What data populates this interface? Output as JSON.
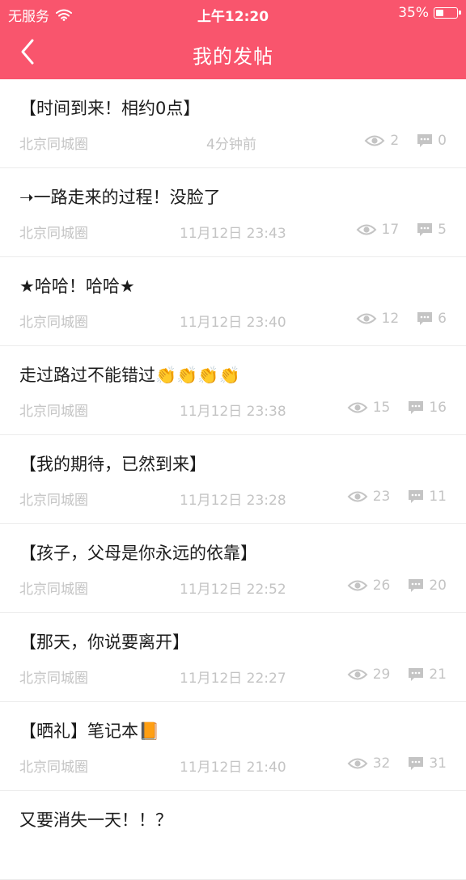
{
  "status_bar": {
    "carrier": "无服务",
    "time": "上午12:20",
    "battery": "35%",
    "battery_level": 0.35
  },
  "nav": {
    "title": "我的发帖"
  },
  "posts": [
    {
      "title": "【时间到来！相约0点】",
      "source": "北京同城圈",
      "time": "4分钟前",
      "views": "2",
      "comments": "0"
    },
    {
      "title": "➝一路走来的过程！没脸了",
      "source": "北京同城圈",
      "time": "11月12日 23:43",
      "views": "17",
      "comments": "5"
    },
    {
      "title": "★哈哈！哈哈★",
      "source": "北京同城圈",
      "time": "11月12日 23:40",
      "views": "12",
      "comments": "6"
    },
    {
      "title": "走过路过不能错过👏👏👏👏",
      "source": "北京同城圈",
      "time": "11月12日 23:38",
      "views": "15",
      "comments": "16"
    },
    {
      "title": "【我的期待，已然到来】",
      "source": "北京同城圈",
      "time": "11月12日 23:28",
      "views": "23",
      "comments": "11"
    },
    {
      "title": "【孩子，父母是你永远的依靠】",
      "source": "北京同城圈",
      "time": "11月12日 22:52",
      "views": "26",
      "comments": "20"
    },
    {
      "title": "【那天，你说要离开】",
      "source": "北京同城圈",
      "time": "11月12日 22:27",
      "views": "29",
      "comments": "21"
    },
    {
      "title": "【晒礼】笔记本📙",
      "source": "北京同城圈",
      "time": "11月12日 21:40",
      "views": "32",
      "comments": "31"
    },
    {
      "title": "又要消失一天！！？",
      "source": "",
      "time": "",
      "views": "",
      "comments": ""
    }
  ],
  "icons": {
    "views": "eye-icon",
    "comments": "comment-icon"
  },
  "colors": {
    "header": "#f9556d",
    "meta": "#c4c4c4"
  }
}
